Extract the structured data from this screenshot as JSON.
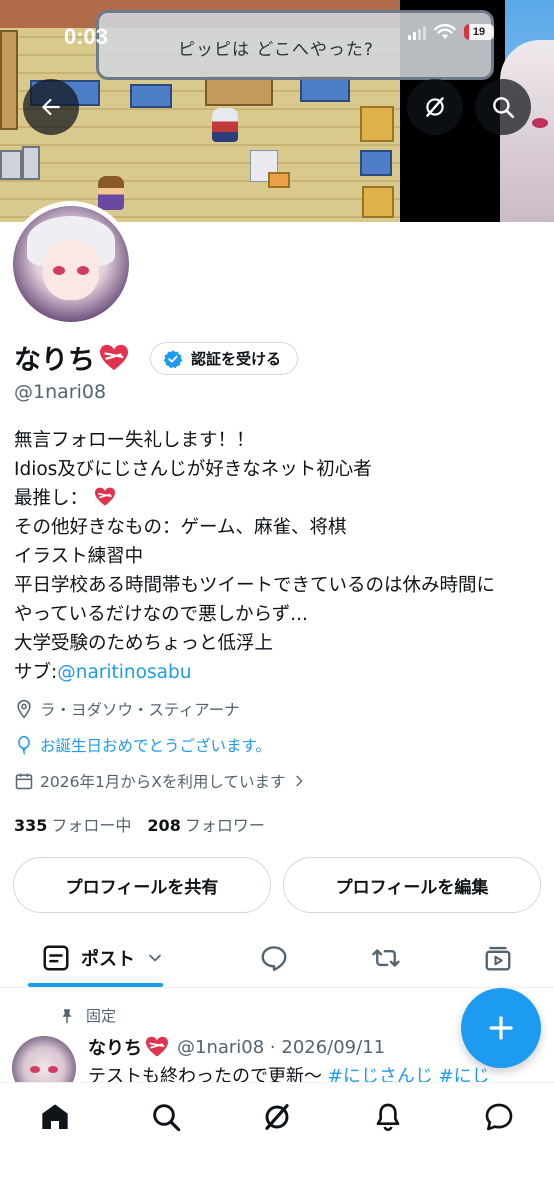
{
  "status_bar": {
    "time": "0:03",
    "battery": "19"
  },
  "banner": {
    "dialog_text": "ピッピは どこへやった?"
  },
  "profile": {
    "display_name": "なりち",
    "verify_label": "認証を受ける",
    "handle": "@1nari08",
    "bio": {
      "line1": "無言フォロー失礼します！！",
      "line2": "Idios及びにじさんじが好きなネット初心者",
      "line3_prefix": "最推し：",
      "line4": "その他好きなもの：ゲーム、麻雀、将棋",
      "line5": "イラスト練習中",
      "line6": "平日学校ある時間帯もツイートできているのは休み時間に",
      "line7": "やっているだけなので悪しからず...",
      "line8": "大学受験のためちょっと低浮上",
      "line9_prefix": "サブ:",
      "sub_link": "@naritinosabu"
    },
    "location": "ラ・ヨダソウ・スティアーナ",
    "birthday": "お誕生日おめでとうございます。",
    "joined": "2026年1月からXを利用しています",
    "following_count": "335",
    "following_label": "フォロー中",
    "followers_count": "208",
    "followers_label": "フォロワー",
    "share_button": "プロフィールを共有",
    "edit_button": "プロフィールを編集"
  },
  "tabs": {
    "posts_label": "ポスト"
  },
  "pinned_post": {
    "pinned_label": "固定",
    "author": "なりち",
    "handle_date": "@1nari08 · 2026/09/11",
    "text": "テストも終わったので更新～ ",
    "tag1": "#にじさんじ",
    "tag2": " #にじ"
  },
  "icons": {
    "back": "arrow-left-icon",
    "grok": "grok-icon",
    "search": "search-icon",
    "verified": "verified-badge-icon",
    "location": "location-pin-icon",
    "balloon": "balloon-icon",
    "calendar": "calendar-icon",
    "pin": "pin-icon",
    "compose": "plus-icon"
  },
  "colors": {
    "accent": "#1d9bf0",
    "text": "#0f1419",
    "secondary": "#536471",
    "heart": "#e0334d"
  }
}
